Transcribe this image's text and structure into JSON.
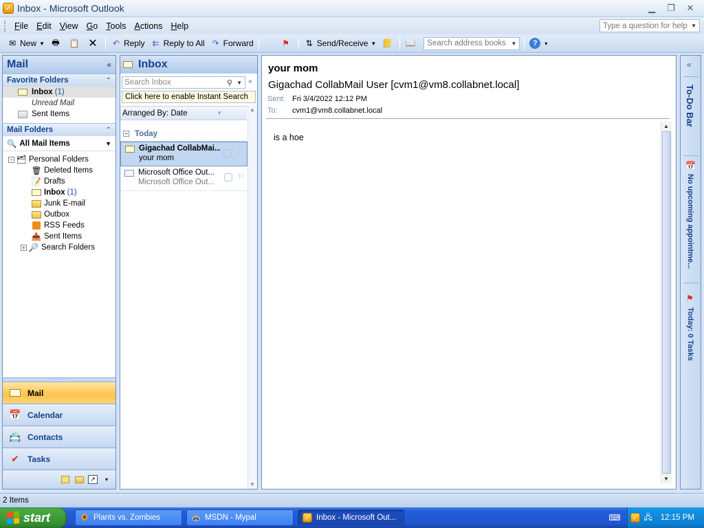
{
  "window": {
    "title": "Inbox - Microsoft Outlook"
  },
  "menu": {
    "items": [
      {
        "pre": "",
        "key": "F",
        "post": "ile"
      },
      {
        "pre": "",
        "key": "E",
        "post": "dit"
      },
      {
        "pre": "",
        "key": "V",
        "post": "iew"
      },
      {
        "pre": "",
        "key": "G",
        "post": "o"
      },
      {
        "pre": "",
        "key": "T",
        "post": "ools"
      },
      {
        "pre": "",
        "key": "A",
        "post": "ctions"
      },
      {
        "pre": "",
        "key": "H",
        "post": "elp"
      }
    ],
    "ask_placeholder": "Type a question for help"
  },
  "toolbar": {
    "new_label": "New",
    "reply_label": "Reply",
    "reply_all_label": "Reply to All",
    "forward_label": "Forward",
    "send_receive_label": "Send/Receive",
    "search_address_placeholder": "Search address books"
  },
  "nav": {
    "header": "Mail",
    "favorites_header": "Favorite Folders",
    "favorites": [
      {
        "label": "Inbox",
        "count": "(1)"
      },
      {
        "label": "Unread Mail",
        "count": ""
      },
      {
        "label": "Sent Items",
        "count": ""
      }
    ],
    "mail_folders_header": "Mail Folders",
    "all_mail_items": "All Mail Items",
    "tree": {
      "root": "Personal Folders",
      "folders": [
        {
          "label": "Deleted Items",
          "count": ""
        },
        {
          "label": "Drafts",
          "count": ""
        },
        {
          "label": "Inbox",
          "count": "(1)"
        },
        {
          "label": "Junk E-mail",
          "count": ""
        },
        {
          "label": "Outbox",
          "count": ""
        },
        {
          "label": "RSS Feeds",
          "count": ""
        },
        {
          "label": "Sent Items",
          "count": ""
        },
        {
          "label": "Search Folders",
          "count": ""
        }
      ]
    },
    "buttons": [
      "Mail",
      "Calendar",
      "Contacts",
      "Tasks"
    ]
  },
  "list": {
    "header": "Inbox",
    "search_placeholder": "Search Inbox",
    "instant_search_text": "Click here to enable Instant Search",
    "arranged_by": "Arranged By: Date",
    "group": "Today",
    "messages": [
      {
        "from": "Gigachad CollabMai...",
        "subject": "your mom",
        "selected": true,
        "unread": true
      },
      {
        "from": "Microsoft Office Out...",
        "subject": "Microsoft Office Out...",
        "selected": false,
        "unread": false
      }
    ]
  },
  "reading": {
    "subject": "your mom",
    "from": "Gigachad CollabMail User [cvm1@vm8.collabnet.local]",
    "sent_label": "Sent:",
    "sent_value": "Fri 3/4/2022 12:12 PM",
    "to_label": "To:",
    "to_value": "cvm1@vm8.collabnet.local",
    "body": "is a hoe"
  },
  "todo": {
    "title": "To-Do Bar",
    "appointments": "No upcoming appointme...",
    "tasks": "Today: 0 Tasks"
  },
  "status": {
    "items_count": "2 Items"
  },
  "taskbar": {
    "start_label": "start",
    "tasks": [
      "Plants vs. Zombies",
      "MSDN - Mypal",
      "Inbox - Microsoft Out..."
    ],
    "clock": "12:15 PM"
  },
  "colors": {
    "accent": "#15428b",
    "nav_active": "#ffc34a",
    "taskbar": "#245edb",
    "start": "#3c9a36"
  }
}
